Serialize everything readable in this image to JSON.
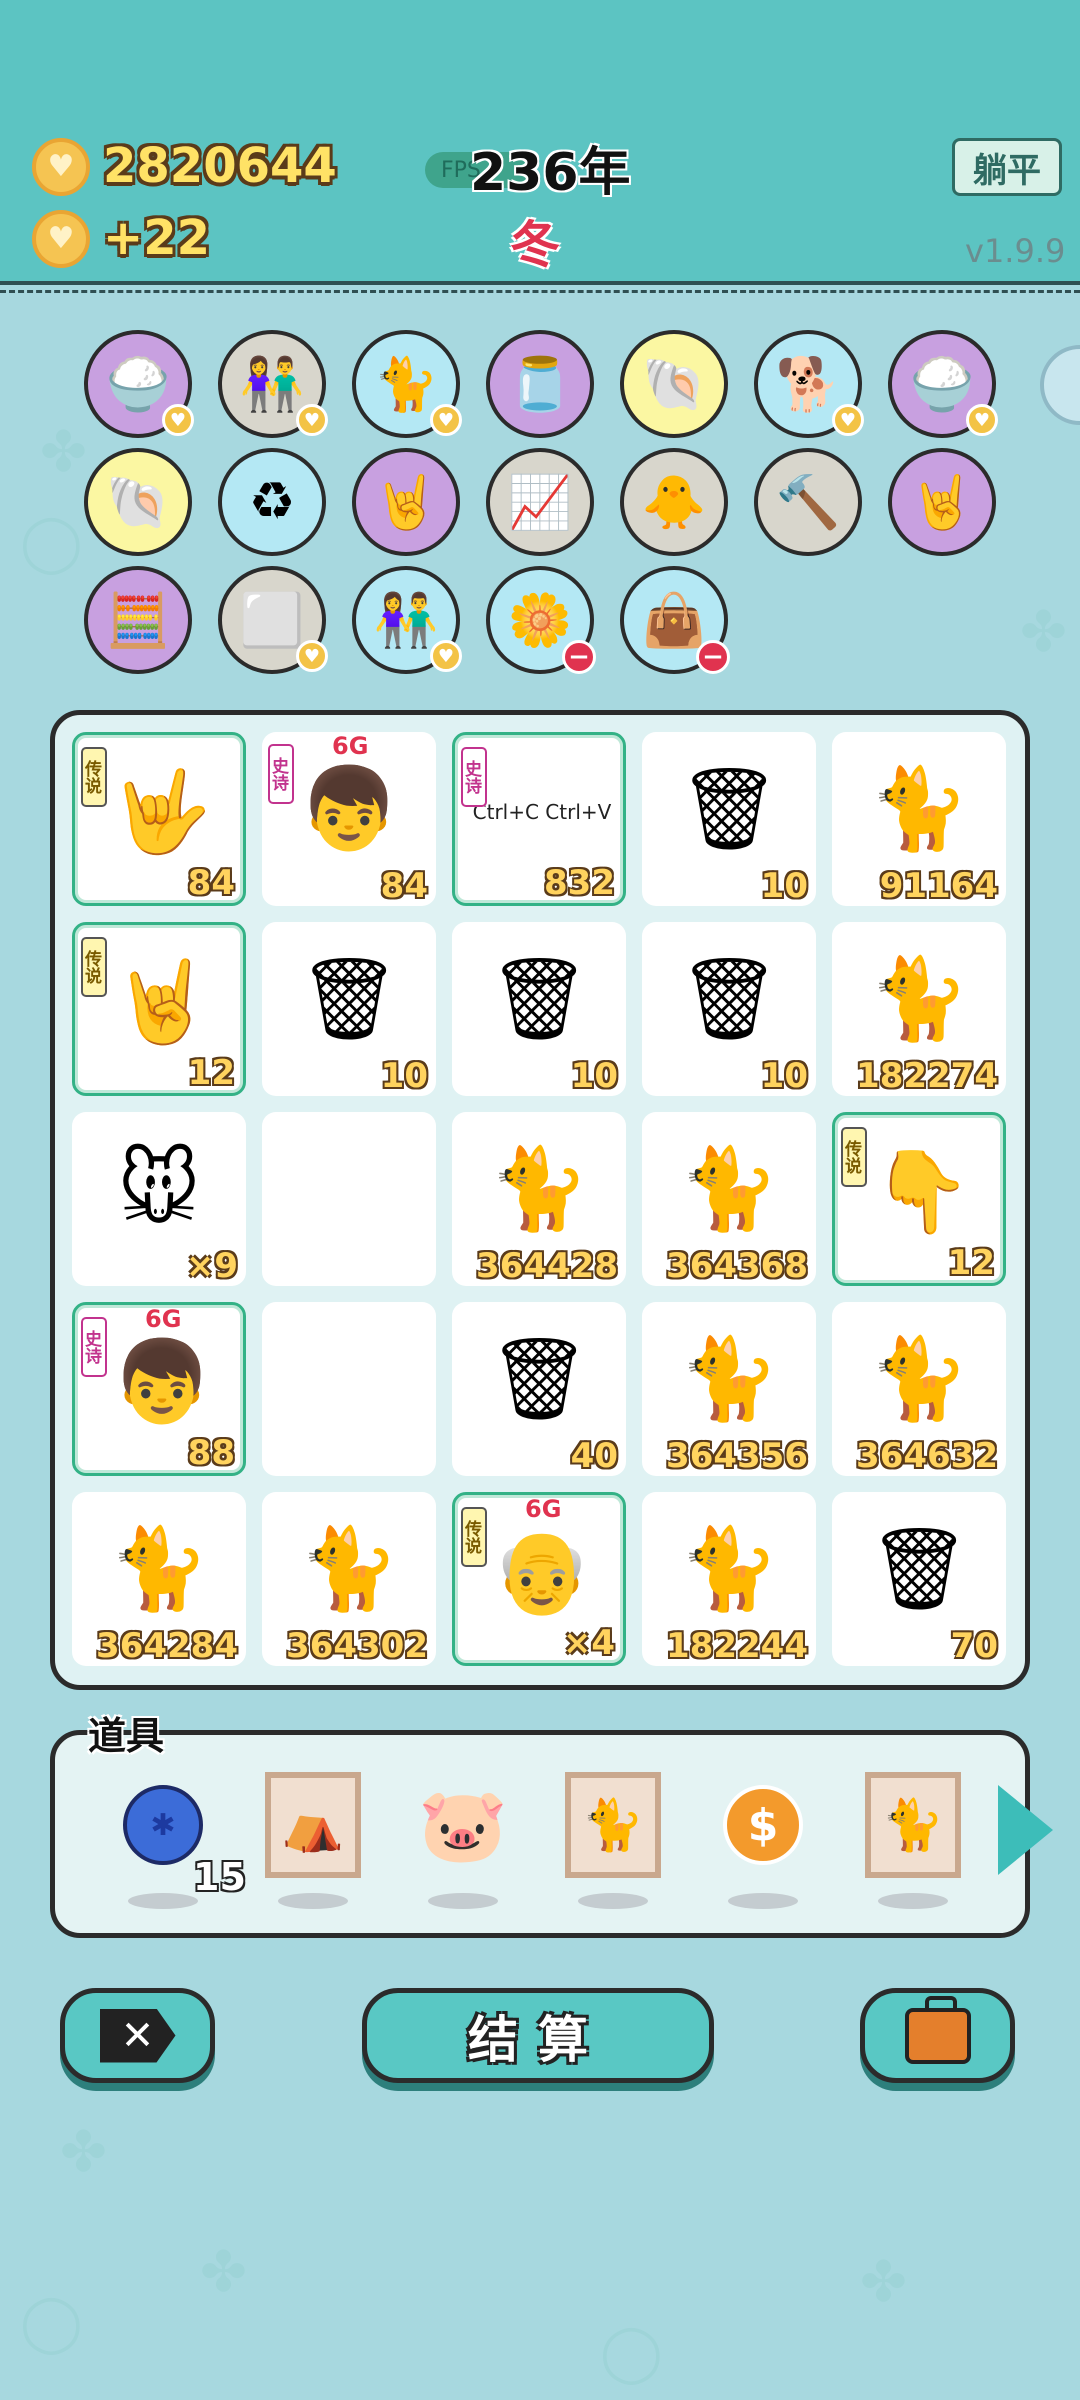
{
  "header": {
    "coins": "2820644",
    "income": "+22",
    "fps_label": "FPS",
    "year": "236年",
    "season": "冬",
    "lie_flat_label": "躺平",
    "version": "v1.9.9"
  },
  "status_icons": [
    {
      "icon": "rice-bowl-icon",
      "glyph": "🍚",
      "color": "#c8a0e0",
      "badge": "heart"
    },
    {
      "icon": "cow-people-icon",
      "glyph": "👫",
      "color": "#d8d6cc",
      "badge": "heart"
    },
    {
      "icon": "cat-tunnel-icon",
      "glyph": "🐈",
      "color": "#b4e8f4",
      "badge": "heart"
    },
    {
      "icon": "jar-icon",
      "glyph": "🫙",
      "color": "#c8a0e0",
      "badge": ""
    },
    {
      "icon": "shell-icon",
      "glyph": "🐚",
      "color": "#fbf7a2",
      "badge": ""
    },
    {
      "icon": "husky-icon",
      "glyph": "🐕",
      "color": "#b4e8f4",
      "badge": "heart"
    },
    {
      "icon": "rice-bowl-icon",
      "glyph": "🍚",
      "color": "#c8a0e0",
      "badge": "heart"
    },
    {
      "icon": "shell-icon",
      "glyph": "🐚",
      "color": "#fbf7a2",
      "badge": ""
    },
    {
      "icon": "recycle-bag-icon",
      "glyph": "♻",
      "color": "#b4e8f4",
      "badge": ""
    },
    {
      "icon": "rock-hand-icon",
      "glyph": "🤘",
      "color": "#c8a0e0",
      "badge": ""
    },
    {
      "icon": "growth-chart-icon",
      "glyph": "📈",
      "color": "#d8d6cc",
      "badge": ""
    },
    {
      "icon": "chick-egg-icon",
      "glyph": "🐥",
      "color": "#d8d6cc",
      "badge": ""
    },
    {
      "icon": "hammer-icon",
      "glyph": "🔨",
      "color": "#d8d6cc",
      "badge": ""
    },
    {
      "icon": "rock-hand-icon",
      "glyph": "🤘",
      "color": "#c8a0e0",
      "badge": ""
    },
    {
      "icon": "math-head-icon",
      "glyph": "🧮",
      "color": "#c8a0e0",
      "badge": ""
    },
    {
      "icon": "sugar-cubes-icon",
      "glyph": "⬜",
      "color": "#d8d6cc",
      "badge": "heart"
    },
    {
      "icon": "cow-people-icon",
      "glyph": "👫",
      "color": "#b4e8f4",
      "badge": "heart"
    },
    {
      "icon": "flower-pot-icon",
      "glyph": "🌼",
      "color": "#b4e8f4",
      "badge": "minus"
    },
    {
      "icon": "green-bag-icon",
      "glyph": "👜",
      "color": "#b4e8f4",
      "badge": "minus"
    }
  ],
  "grid": [
    {
      "icon": "rock-hand-icon",
      "glyph": "🤟",
      "count": "84",
      "rarity": "传说",
      "rarity_type": "legend",
      "tag": "",
      "framed": true
    },
    {
      "icon": "red-hat-boy-icon",
      "glyph": "👦",
      "count": "84",
      "rarity": "史诗",
      "rarity_type": "epic",
      "tag": "6G",
      "framed": false
    },
    {
      "icon": "copy-paste-icon",
      "glyph": "📋",
      "count": "832",
      "rarity": "史诗",
      "rarity_type": "epic",
      "tag": "",
      "framed": true,
      "text": "Ctrl+C Ctrl+V"
    },
    {
      "icon": "trash-bag-icon",
      "glyph": "🗑",
      "count": "10",
      "rarity": "",
      "rarity_type": "",
      "tag": "",
      "framed": false
    },
    {
      "icon": "cat-icon",
      "glyph": "🐈",
      "count": "91164",
      "rarity": "",
      "rarity_type": "",
      "tag": "",
      "framed": false
    },
    {
      "icon": "rock-hand-icon",
      "glyph": "🤘",
      "count": "12",
      "rarity": "传说",
      "rarity_type": "legend",
      "tag": "",
      "framed": true
    },
    {
      "icon": "trash-bag-icon",
      "glyph": "🗑",
      "count": "10",
      "rarity": "",
      "rarity_type": "",
      "tag": "",
      "framed": false
    },
    {
      "icon": "trash-bag-icon",
      "glyph": "🗑",
      "count": "10",
      "rarity": "",
      "rarity_type": "",
      "tag": "",
      "framed": false
    },
    {
      "icon": "trash-bag-icon",
      "glyph": "🗑",
      "count": "10",
      "rarity": "",
      "rarity_type": "",
      "tag": "",
      "framed": false
    },
    {
      "icon": "cat-icon",
      "glyph": "🐈",
      "count": "182274",
      "rarity": "",
      "rarity_type": "",
      "tag": "",
      "framed": false
    },
    {
      "icon": "mouse-icon",
      "glyph": "🐭",
      "count": "×9",
      "rarity": "",
      "rarity_type": "",
      "tag": "",
      "framed": false
    },
    {
      "icon": "empty-slot",
      "glyph": "",
      "count": "",
      "rarity": "",
      "rarity_type": "",
      "tag": "",
      "framed": false
    },
    {
      "icon": "cat-icon",
      "glyph": "🐈",
      "count": "364428",
      "rarity": "",
      "rarity_type": "",
      "tag": "",
      "framed": false
    },
    {
      "icon": "cat-icon",
      "glyph": "🐈",
      "count": "364368",
      "rarity": "",
      "rarity_type": "",
      "tag": "",
      "framed": false
    },
    {
      "icon": "pointing-hand-icon",
      "glyph": "👇",
      "count": "12",
      "rarity": "传说",
      "rarity_type": "legend",
      "tag": "",
      "framed": true
    },
    {
      "icon": "red-hat-boy-icon",
      "glyph": "👦",
      "count": "88",
      "rarity": "史诗",
      "rarity_type": "epic",
      "tag": "6G",
      "framed": true
    },
    {
      "icon": "empty-slot",
      "glyph": "",
      "count": "",
      "rarity": "",
      "rarity_type": "",
      "tag": "",
      "framed": false
    },
    {
      "icon": "trash-bag-icon",
      "glyph": "🗑",
      "count": "40",
      "rarity": "",
      "rarity_type": "",
      "tag": "",
      "framed": false
    },
    {
      "icon": "cat-icon",
      "glyph": "🐈",
      "count": "364356",
      "rarity": "",
      "rarity_type": "",
      "tag": "",
      "framed": false
    },
    {
      "icon": "cat-icon",
      "glyph": "🐈",
      "count": "364632",
      "rarity": "",
      "rarity_type": "",
      "tag": "",
      "framed": false
    },
    {
      "icon": "cat-icon",
      "glyph": "🐈",
      "count": "364284",
      "rarity": "",
      "rarity_type": "",
      "tag": "",
      "framed": false
    },
    {
      "icon": "cat-icon",
      "glyph": "🐈",
      "count": "364302",
      "rarity": "",
      "rarity_type": "",
      "tag": "",
      "framed": false
    },
    {
      "icon": "grinning-old-man-icon",
      "glyph": "👴",
      "count": "×4",
      "rarity": "传说",
      "rarity_type": "legend",
      "tag": "6G",
      "framed": true
    },
    {
      "icon": "cat-icon",
      "glyph": "🐈",
      "count": "182244",
      "rarity": "",
      "rarity_type": "",
      "tag": "",
      "framed": false
    },
    {
      "icon": "trash-bag-icon",
      "glyph": "🗑",
      "count": "70",
      "rarity": "",
      "rarity_type": "",
      "tag": "",
      "framed": false
    }
  ],
  "props": {
    "title": "道具",
    "first_count": "15",
    "items": [
      {
        "icon": "blue-ball-icon"
      },
      {
        "icon": "windmill-picture-icon"
      },
      {
        "icon": "piggy-bank-icon"
      },
      {
        "icon": "cat-picture-icon"
      },
      {
        "icon": "dollar-coin-icon"
      },
      {
        "icon": "cat-picture-icon"
      }
    ]
  },
  "buttons": {
    "cancel_icon": "close-tag-icon",
    "settle_label": "结算",
    "bag_icon": "briefcase-icon"
  }
}
